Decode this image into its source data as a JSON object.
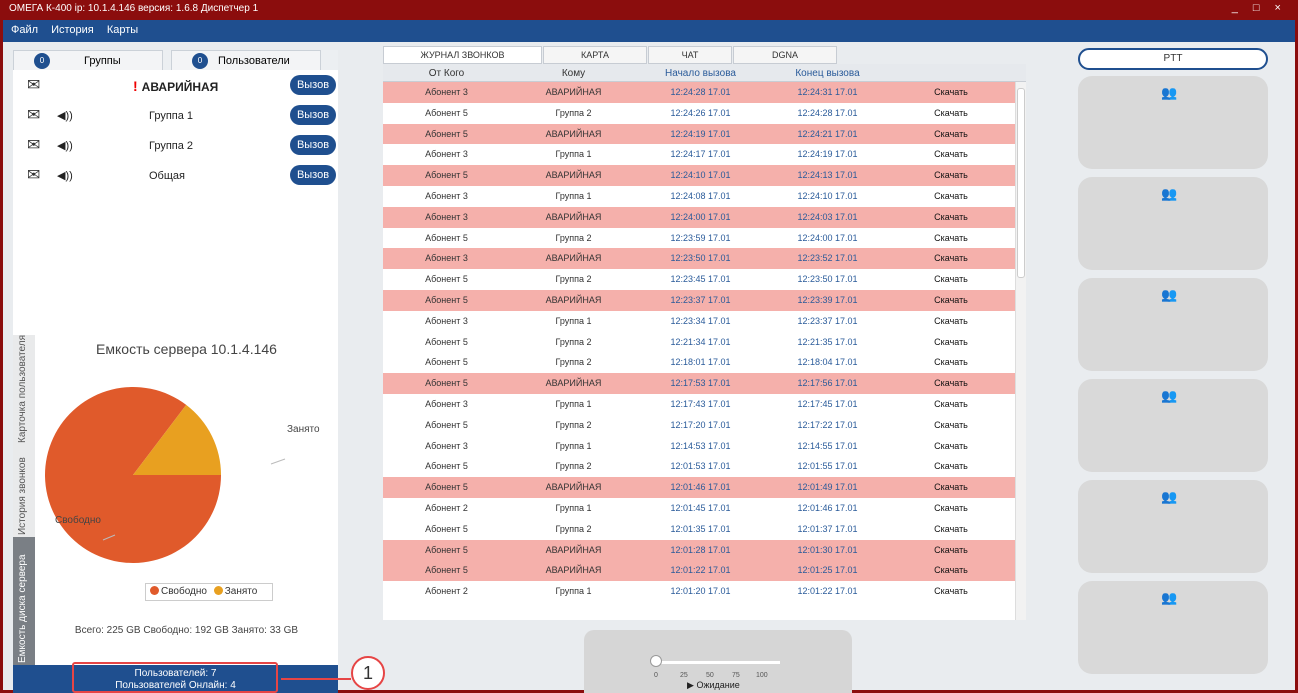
{
  "window": {
    "title": "ОМЕГА К-400  ip: 10.1.4.146  версия: 1.6.8  Диспетчер 1",
    "controls": "_ □ ×"
  },
  "menu": [
    "Файл",
    "История",
    "Карты"
  ],
  "left_tabs": [
    {
      "label": "Группы",
      "badge": "0"
    },
    {
      "label": "Пользователи",
      "badge": "0"
    }
  ],
  "groups": [
    {
      "name": "АВАРИЙНАЯ",
      "alert": "!",
      "call": "Вызов"
    },
    {
      "name": "Группа 1",
      "call": "Вызов"
    },
    {
      "name": "Группа 2",
      "call": "Вызов"
    },
    {
      "name": "Общая",
      "call": "Вызов"
    }
  ],
  "vertical_tabs": [
    "Карточка пользователя",
    "История звонков",
    "Емкость диска сервера"
  ],
  "capacity": {
    "title": "Емкость сервера 10.1.4.146",
    "label_busy": "Занято",
    "label_free": "Свободно",
    "legend_free": "Свободно",
    "legend_busy": "Занято",
    "disk_text": "Всего: 225 GB    Свободно: 192 GB    Занято: 33 GB",
    "total_gb": 225,
    "free_gb": 192,
    "busy_gb": 33,
    "color_free": "#e05a2b",
    "color_busy": "#e8a020"
  },
  "status": {
    "users": "Пользователей: 7",
    "online": "Пользователей Онлайн: 4"
  },
  "callout": {
    "number": "1"
  },
  "center_tabs": [
    "ЖУРНАЛ ЗВОНКОВ",
    "КАРТА",
    "ЧАТ",
    "DGNA"
  ],
  "table_headers": [
    "От Кого",
    "Кому",
    "Начало вызова",
    "Конец вызова"
  ],
  "download_label": "Скачать",
  "rows": [
    [
      "Абонент 3",
      "АВАРИЙНАЯ",
      "12:24:28 17.01",
      "12:24:31 17.01"
    ],
    [
      "Абонент 5",
      "Группа 2",
      "12:24:26 17.01",
      "12:24:28 17.01"
    ],
    [
      "Абонент 5",
      "АВАРИЙНАЯ",
      "12:24:19 17.01",
      "12:24:21 17.01"
    ],
    [
      "Абонент 3",
      "Группа 1",
      "12:24:17 17.01",
      "12:24:19 17.01"
    ],
    [
      "Абонент 5",
      "АВАРИЙНАЯ",
      "12:24:10 17.01",
      "12:24:13 17.01"
    ],
    [
      "Абонент 3",
      "Группа 1",
      "12:24:08 17.01",
      "12:24:10 17.01"
    ],
    [
      "Абонент 3",
      "АВАРИЙНАЯ",
      "12:24:00 17.01",
      "12:24:03 17.01"
    ],
    [
      "Абонент 5",
      "Группа 2",
      "12:23:59 17.01",
      "12:24:00 17.01"
    ],
    [
      "Абонент 3",
      "АВАРИЙНАЯ",
      "12:23:50 17.01",
      "12:23:52 17.01"
    ],
    [
      "Абонент 5",
      "Группа 2",
      "12:23:45 17.01",
      "12:23:50 17.01"
    ],
    [
      "Абонент 5",
      "АВАРИЙНАЯ",
      "12:23:37 17.01",
      "12:23:39 17.01"
    ],
    [
      "Абонент 3",
      "Группа 1",
      "12:23:34 17.01",
      "12:23:37 17.01"
    ],
    [
      "Абонент 5",
      "Группа 2",
      "12:21:34 17.01",
      "12:21:35 17.01"
    ],
    [
      "Абонент 5",
      "Группа 2",
      "12:18:01 17.01",
      "12:18:04 17.01"
    ],
    [
      "Абонент 5",
      "АВАРИЙНАЯ",
      "12:17:53 17.01",
      "12:17:56 17.01"
    ],
    [
      "Абонент 3",
      "Группа 1",
      "12:17:43 17.01",
      "12:17:45 17.01"
    ],
    [
      "Абонент 5",
      "Группа 2",
      "12:17:20 17.01",
      "12:17:22 17.01"
    ],
    [
      "Абонент 3",
      "Группа 1",
      "12:14:53 17.01",
      "12:14:55 17.01"
    ],
    [
      "Абонент 5",
      "Группа 2",
      "12:01:53 17.01",
      "12:01:55 17.01"
    ],
    [
      "Абонент 5",
      "АВАРИЙНАЯ",
      "12:01:46 17.01",
      "12:01:49 17.01"
    ],
    [
      "Абонент 2",
      "Группа 1",
      "12:01:45 17.01",
      "12:01:46 17.01"
    ],
    [
      "Абонент 5",
      "Группа 2",
      "12:01:35 17.01",
      "12:01:37 17.01"
    ],
    [
      "Абонент 5",
      "АВАРИЙНАЯ",
      "12:01:28 17.01",
      "12:01:30 17.01"
    ],
    [
      "Абонент 5",
      "АВАРИЙНАЯ",
      "12:01:22 17.01",
      "12:01:25 17.01"
    ],
    [
      "Абонент 2",
      "Группа 1",
      "12:01:20 17.01",
      "12:01:22 17.01"
    ]
  ],
  "player": {
    "ticks": [
      "0",
      "25",
      "50",
      "75",
      "100"
    ],
    "status": "Ожидание",
    "position": 0
  },
  "ptt_label": "PTT",
  "ptt_cards": 6
}
